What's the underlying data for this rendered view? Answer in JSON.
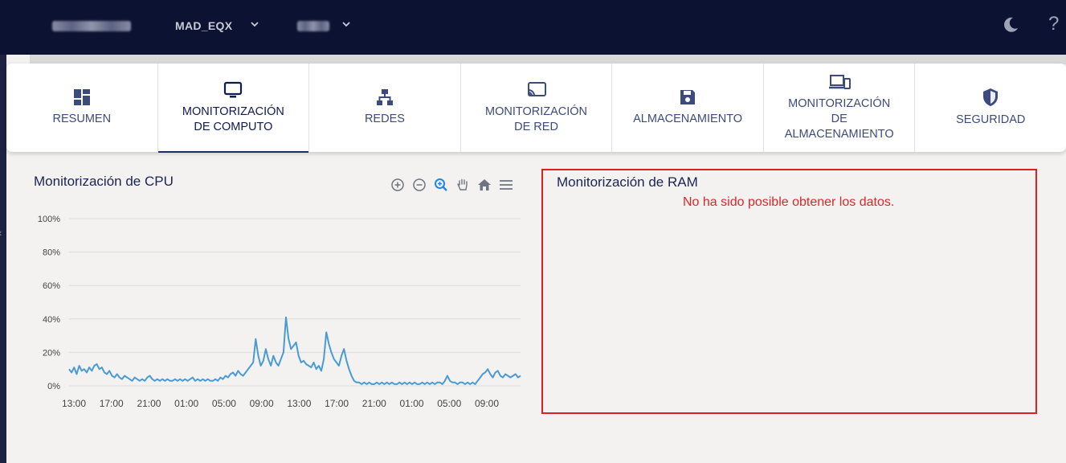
{
  "header": {
    "selectors": [
      {
        "label": "MAD_EQX"
      }
    ],
    "icons": [
      "moon-icon",
      "help-icon"
    ]
  },
  "tabs": [
    {
      "label": "RESUMEN",
      "icon": "dashboard-icon"
    },
    {
      "label": "MONITORIZACIÓN\nDE COMPUTO",
      "icon": "monitor-icon",
      "active": true
    },
    {
      "label": "REDES",
      "icon": "network-icon"
    },
    {
      "label": "MONITORIZACIÓN\nDE RED",
      "icon": "cast-icon"
    },
    {
      "label": "ALMACENAMIENTO",
      "icon": "floppy-icon"
    },
    {
      "label": "MONITORIZACIÓN\nDE\nALMACENAMIENTO",
      "icon": "devices-icon"
    },
    {
      "label": "SEGURIDAD",
      "icon": "shield-icon"
    }
  ],
  "cpu_panel": {
    "title": "Monitorización de CPU",
    "toolbar": [
      "zoom-in-icon",
      "zoom-out-icon",
      "magnifier-icon",
      "pan-hand-icon",
      "home-icon",
      "menu-icon"
    ]
  },
  "ram_panel": {
    "title": "Monitorización de RAM",
    "error": "No ha sido posible obtener los datos."
  },
  "chart_data": {
    "type": "area",
    "title": "Monitorización de CPU",
    "xlabel": "",
    "ylabel": "",
    "ylim": [
      0,
      100
    ],
    "yticks": [
      "0%",
      "20%",
      "40%",
      "60%",
      "80%",
      "100%"
    ],
    "xticks": [
      "13:00",
      "17:00",
      "21:00",
      "01:00",
      "05:00",
      "09:00",
      "13:00",
      "17:00",
      "21:00",
      "01:00",
      "05:00",
      "09:00"
    ],
    "grid": true,
    "legend": "none",
    "color": "#4a9bd2",
    "series": [
      {
        "values": [
          10,
          8,
          11,
          7,
          12,
          9,
          10,
          8,
          11,
          9,
          12,
          13,
          10,
          11,
          8,
          7,
          9,
          6,
          5,
          7,
          5,
          4,
          6,
          5,
          4,
          3,
          5,
          4,
          3,
          4,
          3,
          5,
          6,
          4,
          3,
          4,
          3,
          4,
          3,
          4,
          3,
          3,
          4,
          3,
          4,
          3,
          4,
          3,
          4,
          5,
          3,
          4,
          3,
          4,
          3,
          4,
          3,
          3,
          4,
          3,
          5,
          4,
          6,
          5,
          7,
          8,
          6,
          9,
          7,
          6,
          8,
          10,
          12,
          14,
          28,
          18,
          12,
          15,
          22,
          16,
          12,
          18,
          14,
          12,
          16,
          20,
          41,
          28,
          22,
          24,
          26,
          18,
          14,
          15,
          13,
          12,
          11,
          14,
          10,
          12,
          9,
          16,
          32,
          25,
          20,
          16,
          14,
          12,
          18,
          22,
          15,
          10,
          6,
          3,
          2,
          2,
          1,
          2,
          1,
          2,
          1,
          1,
          2,
          1,
          2,
          1,
          2,
          1,
          2,
          1,
          1,
          2,
          1,
          2,
          1,
          2,
          1,
          2,
          1,
          1,
          2,
          1,
          2,
          1,
          2,
          1,
          2,
          2,
          1,
          3,
          6,
          3,
          2,
          2,
          1,
          2,
          2,
          1,
          2,
          1,
          2,
          1,
          3,
          5,
          7,
          8,
          10,
          7,
          5,
          8,
          9,
          6,
          5,
          7,
          6,
          5,
          6,
          7,
          5,
          6
        ]
      }
    ]
  }
}
